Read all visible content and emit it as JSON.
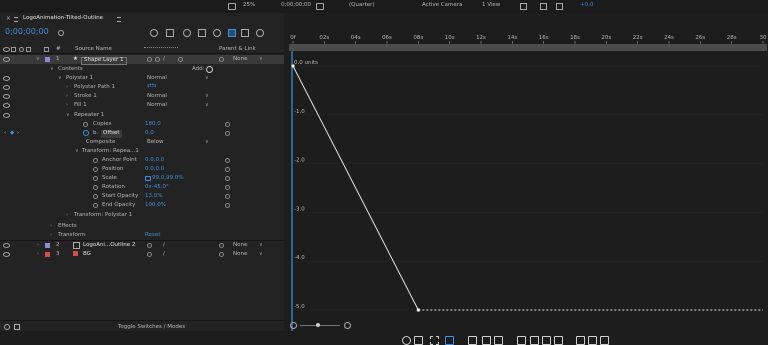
{
  "viewer_bar": {
    "zoom": "25%",
    "timecode": "0;00;00;00",
    "resolution": "(Quarter)",
    "camera": "Active Camera",
    "views": "1 View",
    "extra": "+0.0"
  },
  "comp_tab": {
    "title": "LogoAnimation-Tilted-Outline"
  },
  "timecode": "0;00;00;00",
  "columns": {
    "source_name": "Source Name",
    "parent": "Parent & Link"
  },
  "layers": [
    {
      "num": "1",
      "name": "Shape Layer 1",
      "parent": "None",
      "color": "#8b8bd6"
    },
    {
      "num": "2",
      "name": "LogoAni...Outline 2",
      "parent": "None",
      "color": "#8b8bd6"
    },
    {
      "num": "3",
      "name": "BG",
      "parent": "None",
      "color": "#d34b4b"
    }
  ],
  "props": {
    "contents": "Contents",
    "add": "Add:",
    "polystar": "Polystar 1",
    "polystar_mode": "Normal",
    "polystar_path": "Polystar Path 1",
    "stroke": "Stroke 1",
    "stroke_mode": "Normal",
    "fill": "Fill 1",
    "fill_mode": "Normal",
    "repeater": "Repeater 1",
    "copies_label": "Copies",
    "copies_value": "180.0",
    "offset_prefix": "b.",
    "offset_label": "Offset",
    "offset_value": "0.0",
    "composite_label": "Composite",
    "composite_value": "Below",
    "transform_rep": "Transform: Repea...1",
    "anchor_label": "Anchor Point",
    "anchor_value": "0.0,0.0",
    "position_label": "Position",
    "position_value": "0.0,0.0",
    "scale_label": "Scale",
    "scale_value": "99.0,99.0%",
    "rotation_label": "Rotation",
    "rotation_value": "0x-45.0°",
    "start_op_label": "Start Opacity",
    "start_op_value": "13.0%",
    "end_op_label": "End Opacity",
    "end_op_value": "100.0%",
    "transform_poly": "Transform: Polystar 1",
    "effects": "Effects",
    "transform": "Transform",
    "reset": "Reset"
  },
  "toggle_label": "Toggle Switches / Modes",
  "ruler_ticks": [
    "0f",
    "02s",
    "04s",
    "06s",
    "08s",
    "10s",
    "12s",
    "14s",
    "16s",
    "18s",
    "20s",
    "22s",
    "24s",
    "26s",
    "28s",
    "30"
  ],
  "graph": {
    "y_labels": [
      "0.0 units",
      "-1.0",
      "-2.0",
      "-3.0",
      "-4.0",
      "-5.0"
    ],
    "points": [
      [
        0,
        0
      ],
      [
        8,
        -5
      ],
      [
        30,
        -5
      ]
    ],
    "x_range": [
      0,
      30
    ],
    "y_range": [
      0,
      -5
    ]
  },
  "colors": {
    "accent": "#3d8fe0",
    "panel": "#232323",
    "bg": "#1d1d1d"
  }
}
